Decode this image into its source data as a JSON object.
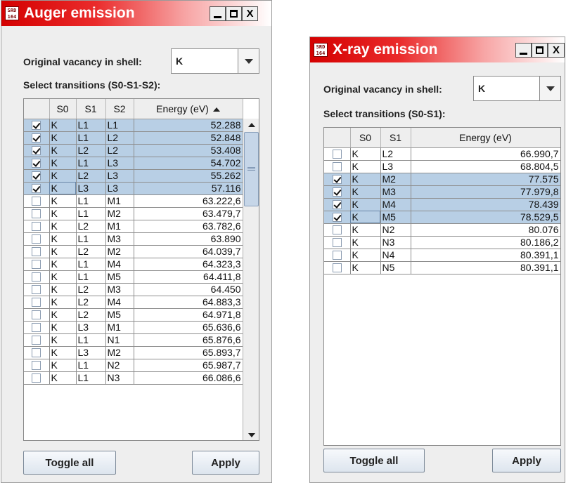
{
  "auger": {
    "logo_text": "SRD 164",
    "title": "Auger emission",
    "window_buttons": {
      "minimize": "_",
      "maximize": "□",
      "close": "X"
    },
    "vacancy_label": "Original vacancy in shell:",
    "vacancy_value": "K",
    "transitions_label": "Select transitions (S0-S1-S2):",
    "columns": [
      "",
      "S0",
      "S1",
      "S2",
      "Energy (eV)"
    ],
    "sort_column": "Energy (eV)",
    "sort_direction": "ascending",
    "rows": [
      {
        "checked": true,
        "s0": "K",
        "s1": "L1",
        "s2": "L1",
        "energy": "52.288"
      },
      {
        "checked": true,
        "s0": "K",
        "s1": "L1",
        "s2": "L2",
        "energy": "52.848"
      },
      {
        "checked": true,
        "s0": "K",
        "s1": "L2",
        "s2": "L2",
        "energy": "53.408"
      },
      {
        "checked": true,
        "s0": "K",
        "s1": "L1",
        "s2": "L3",
        "energy": "54.702"
      },
      {
        "checked": true,
        "s0": "K",
        "s1": "L2",
        "s2": "L3",
        "energy": "55.262"
      },
      {
        "checked": true,
        "s0": "K",
        "s1": "L3",
        "s2": "L3",
        "energy": "57.116"
      },
      {
        "checked": false,
        "s0": "K",
        "s1": "L1",
        "s2": "M1",
        "energy": "63.222,6"
      },
      {
        "checked": false,
        "s0": "K",
        "s1": "L1",
        "s2": "M2",
        "energy": "63.479,7"
      },
      {
        "checked": false,
        "s0": "K",
        "s1": "L2",
        "s2": "M1",
        "energy": "63.782,6"
      },
      {
        "checked": false,
        "s0": "K",
        "s1": "L1",
        "s2": "M3",
        "energy": "63.890"
      },
      {
        "checked": false,
        "s0": "K",
        "s1": "L2",
        "s2": "M2",
        "energy": "64.039,7"
      },
      {
        "checked": false,
        "s0": "K",
        "s1": "L1",
        "s2": "M4",
        "energy": "64.323,3"
      },
      {
        "checked": false,
        "s0": "K",
        "s1": "L1",
        "s2": "M5",
        "energy": "64.411,8"
      },
      {
        "checked": false,
        "s0": "K",
        "s1": "L2",
        "s2": "M3",
        "energy": "64.450"
      },
      {
        "checked": false,
        "s0": "K",
        "s1": "L2",
        "s2": "M4",
        "energy": "64.883,3"
      },
      {
        "checked": false,
        "s0": "K",
        "s1": "L2",
        "s2": "M5",
        "energy": "64.971,8"
      },
      {
        "checked": false,
        "s0": "K",
        "s1": "L3",
        "s2": "M1",
        "energy": "65.636,6"
      },
      {
        "checked": false,
        "s0": "K",
        "s1": "L1",
        "s2": "N1",
        "energy": "65.876,6"
      },
      {
        "checked": false,
        "s0": "K",
        "s1": "L3",
        "s2": "M2",
        "energy": "65.893,7"
      },
      {
        "checked": false,
        "s0": "K",
        "s1": "L1",
        "s2": "N2",
        "energy": "65.987,7"
      },
      {
        "checked": false,
        "s0": "K",
        "s1": "L1",
        "s2": "N3",
        "energy": "66.086,6"
      }
    ],
    "toggle_label": "Toggle all",
    "apply_label": "Apply"
  },
  "xray": {
    "logo_text": "SRD 164",
    "title": "X-ray emission",
    "window_buttons": {
      "minimize": "_",
      "maximize": "□",
      "close": "X"
    },
    "vacancy_label": "Original vacancy in shell:",
    "vacancy_value": "K",
    "transitions_label": "Select transitions (S0-S1):",
    "columns": [
      "",
      "S0",
      "S1",
      "Energy (eV)"
    ],
    "rows": [
      {
        "checked": false,
        "s0": "K",
        "s1": "L2",
        "energy": "66.990,7"
      },
      {
        "checked": false,
        "s0": "K",
        "s1": "L3",
        "energy": "68.804,5"
      },
      {
        "checked": true,
        "s0": "K",
        "s1": "M2",
        "energy": "77.575"
      },
      {
        "checked": true,
        "s0": "K",
        "s1": "M3",
        "energy": "77.979,8"
      },
      {
        "checked": true,
        "s0": "K",
        "s1": "M4",
        "energy": "78.439"
      },
      {
        "checked": true,
        "s0": "K",
        "s1": "M5",
        "energy": "78.529,5"
      },
      {
        "checked": false,
        "s0": "K",
        "s1": "N2",
        "energy": "80.076"
      },
      {
        "checked": false,
        "s0": "K",
        "s1": "N3",
        "energy": "80.186,2"
      },
      {
        "checked": false,
        "s0": "K",
        "s1": "N4",
        "energy": "80.391,1"
      },
      {
        "checked": false,
        "s0": "K",
        "s1": "N5",
        "energy": "80.391,1"
      }
    ],
    "toggle_label": "Toggle all",
    "apply_label": "Apply"
  },
  "colors": {
    "title_gradient_start": "#d40000",
    "selection": "#b8cfe5",
    "window_bg": "#eeeeee"
  }
}
